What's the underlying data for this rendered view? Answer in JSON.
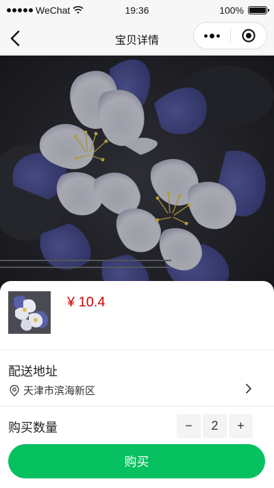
{
  "status_bar": {
    "carrier": "WeChat",
    "time": "19:36",
    "battery": "100%"
  },
  "nav": {
    "title": "宝贝详情"
  },
  "product": {
    "price": "¥ 10.4"
  },
  "delivery": {
    "title": "配送地址",
    "address": "天津市滨海新区"
  },
  "quantity": {
    "title": "购买数量",
    "minus": "−",
    "value": "2",
    "plus": "+"
  },
  "buy_button": {
    "label": "购买"
  },
  "colors": {
    "accent_green": "#07c160",
    "price_red": "#c00000"
  }
}
